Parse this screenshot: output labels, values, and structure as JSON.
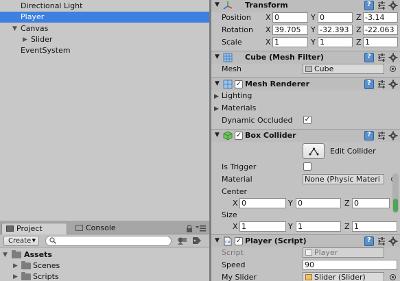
{
  "hierarchy": {
    "items": [
      {
        "label": "Directional Light",
        "depth": 1,
        "arrow": "",
        "selected": false
      },
      {
        "label": "Player",
        "depth": 1,
        "arrow": "",
        "selected": true
      },
      {
        "label": "Canvas",
        "depth": 1,
        "arrow": "▼",
        "selected": false
      },
      {
        "label": "Slider",
        "depth": 2,
        "arrow": "▶",
        "selected": false
      },
      {
        "label": "EventSystem",
        "depth": 1,
        "arrow": "",
        "selected": false
      }
    ]
  },
  "project": {
    "tabs": [
      {
        "label": "Project",
        "active": true
      },
      {
        "label": "Console",
        "active": false
      }
    ],
    "create_label": "Create",
    "create_arrow": "▼",
    "search_placeholder": "",
    "tree": [
      {
        "label": "Assets",
        "depth": 0,
        "bold": true,
        "arrow": "▼"
      },
      {
        "label": "Scenes",
        "depth": 1,
        "bold": false,
        "arrow": "▶"
      },
      {
        "label": "Scripts",
        "depth": 1,
        "bold": false,
        "arrow": "▶"
      }
    ]
  },
  "inspector": {
    "transform": {
      "title": "Transform",
      "fold": "▼",
      "position": {
        "label": "Position",
        "x": "0",
        "y": "0",
        "z": "-3.14"
      },
      "rotation": {
        "label": "Rotation",
        "x": "39.705",
        "y": "-32.393",
        "z": "-22.063"
      },
      "scale": {
        "label": "Scale",
        "x": "1",
        "y": "1",
        "z": "1"
      },
      "axis": {
        "x": "X",
        "y": "Y",
        "z": "Z"
      }
    },
    "mesh_filter": {
      "title": "Cube (Mesh Filter)",
      "fold": "▼",
      "mesh_label": "Mesh",
      "mesh_value": "Cube"
    },
    "mesh_renderer": {
      "title": "Mesh Renderer",
      "fold": "▼",
      "enabled_mark": "✓",
      "lighting_label": "Lighting",
      "materials_label": "Materials",
      "fold_closed": "▶",
      "dynamic_occluded_label": "Dynamic Occluded",
      "dynamic_occluded_mark": "✓"
    },
    "box_collider": {
      "title": "Box Collider",
      "fold": "▼",
      "enabled_mark": "✓",
      "edit_collider_label": "Edit Collider",
      "is_trigger_label": "Is Trigger",
      "material_label": "Material",
      "material_value": "None (Physic Materi",
      "center_label": "Center",
      "center": {
        "x": "0",
        "y": "0",
        "z": "0"
      },
      "size_label": "Size",
      "size": {
        "x": "1",
        "y": "1",
        "z": "1"
      }
    },
    "player_script": {
      "title": "Player (Script)",
      "fold": "▼",
      "enabled_mark": "✓",
      "script_label": "Script",
      "script_value": "Player",
      "speed_label": "Speed",
      "speed_value": "90",
      "my_slider_label": "My Slider",
      "my_slider_value": "Slider (Slider)"
    }
  },
  "colors": {
    "selection": "#3d80df",
    "panel": "#c2c2c2",
    "scroll_thumb": "#4ea552"
  }
}
